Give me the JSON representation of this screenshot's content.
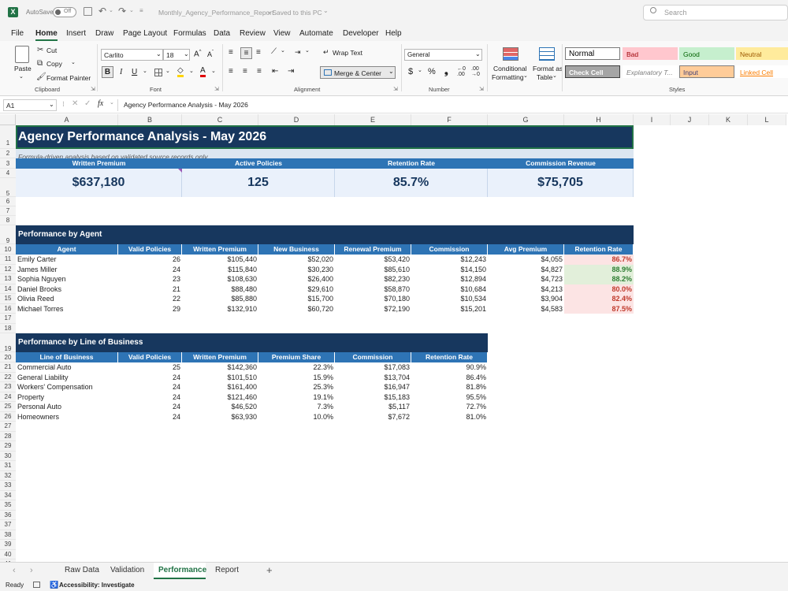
{
  "titlebar": {
    "autosave": "AutoSave",
    "autosave_state": "Off",
    "filename": "Monthly_Agency_Performance_Report",
    "saved": "• Saved to this PC",
    "search_placeholder": "Search"
  },
  "menu": [
    "File",
    "Home",
    "Insert",
    "Draw",
    "Page Layout",
    "Formulas",
    "Data",
    "Review",
    "View",
    "Automate",
    "Developer",
    "Help"
  ],
  "ribbon": {
    "paste": "Paste",
    "cut": "Cut",
    "copy": "Copy",
    "format_painter": "Format Painter",
    "clipboard": "Clipboard",
    "font_name": "Carlito",
    "font_size": "18",
    "font": "Font",
    "wrap_text": "Wrap Text",
    "merge_center": "Merge & Center",
    "alignment": "Alignment",
    "number_format": "General",
    "number": "Number",
    "conditional_formatting_1": "Conditional",
    "conditional_formatting_2": "Formatting",
    "format_as_table_1": "Format as",
    "format_as_table_2": "Table",
    "styles": "Styles",
    "style_cells": [
      {
        "label": "Normal",
        "bg": "#ffffff",
        "fg": "#000000",
        "border": "#7a7a7a"
      },
      {
        "label": "Bad",
        "bg": "#ffc7ce",
        "fg": "#9c0006",
        "border": "#ffc7ce"
      },
      {
        "label": "Good",
        "bg": "#c6efce",
        "fg": "#006100",
        "border": "#c6efce"
      },
      {
        "label": "Neutral",
        "bg": "#ffeb9c",
        "fg": "#9c5700",
        "border": "#ffeb9c"
      },
      {
        "label": "Check Cell",
        "bg": "#a5a5a5",
        "fg": "#ffffff",
        "border": "#3f3f3f"
      },
      {
        "label": "Explanatory T...",
        "bg": "#ffffff",
        "fg": "#7f7f7f",
        "border": "#ffffff"
      },
      {
        "label": "Input",
        "bg": "#ffcc99",
        "fg": "#3f3f76",
        "border": "#7f7f7f"
      },
      {
        "label": "Linked Cell",
        "bg": "#ffffff",
        "fg": "#fa7d00",
        "border": "#ffffff"
      }
    ]
  },
  "formula": {
    "cell_ref": "A1",
    "fx": "fx",
    "content": "Agency Performance Analysis - May 2026"
  },
  "columns": [
    "A",
    "B",
    "C",
    "D",
    "E",
    "F",
    "G",
    "H",
    "I",
    "J",
    "K",
    "L"
  ],
  "rows": [
    "1",
    "2",
    "3",
    "4",
    "5",
    "6",
    "7",
    "8",
    "9",
    "10",
    "11",
    "12",
    "13",
    "14",
    "15",
    "16",
    "17",
    "18",
    "19",
    "20",
    "21",
    "22",
    "23",
    "24",
    "25",
    "26",
    "27",
    "28",
    "29",
    "30",
    "31",
    "32",
    "33",
    "34",
    "35",
    "36",
    "37",
    "38",
    "39",
    "40",
    "41"
  ],
  "sheet": {
    "title": "Agency Performance Analysis - May 2026",
    "subtitle": "Formula-driven analysis based on validated source records only",
    "kpis": [
      {
        "label": "Written Premium",
        "value": "$637,180"
      },
      {
        "label": "Active Policies",
        "value": "125"
      },
      {
        "label": "Retention Rate",
        "value": "85.7%"
      },
      {
        "label": "Commission Revenue",
        "value": "$75,705"
      }
    ],
    "agent_section": "Performance by Agent",
    "agent_headers": [
      "Agent",
      "Valid Policies",
      "Written Premium",
      "New Business",
      "Renewal Premium",
      "Commission",
      "Avg Premium",
      "Retention Rate"
    ],
    "agents": [
      [
        "Emily Carter",
        "26",
        "$105,440",
        "$52,020",
        "$53,420",
        "$12,243",
        "$4,055",
        "86.7%"
      ],
      [
        "James Miller",
        "24",
        "$115,840",
        "$30,230",
        "$85,610",
        "$14,150",
        "$4,827",
        "88.9%"
      ],
      [
        "Sophia Nguyen",
        "23",
        "$108,630",
        "$26,400",
        "$82,230",
        "$12,894",
        "$4,723",
        "88.2%"
      ],
      [
        "Daniel Brooks",
        "21",
        "$88,480",
        "$29,610",
        "$58,870",
        "$10,684",
        "$4,213",
        "80.0%"
      ],
      [
        "Olivia Reed",
        "22",
        "$85,880",
        "$15,700",
        "$70,180",
        "$10,534",
        "$3,904",
        "82.4%"
      ],
      [
        "Michael Torres",
        "29",
        "$132,910",
        "$60,720",
        "$72,190",
        "$15,201",
        "$4,583",
        "87.5%"
      ]
    ],
    "agent_retention_status": [
      "bad",
      "good",
      "good",
      "bad",
      "bad",
      "bad"
    ],
    "lob_section": "Performance by Line of Business",
    "lob_headers": [
      "Line of Business",
      "Valid Policies",
      "Written Premium",
      "Premium Share",
      "Commission",
      "Retention Rate"
    ],
    "lobs": [
      [
        "Commercial Auto",
        "25",
        "$142,360",
        "22.3%",
        "$17,083",
        "90.9%"
      ],
      [
        "General Liability",
        "24",
        "$101,510",
        "15.9%",
        "$13,704",
        "86.4%"
      ],
      [
        "Workers' Compensation",
        "24",
        "$161,400",
        "25.3%",
        "$16,947",
        "81.8%"
      ],
      [
        "Property",
        "24",
        "$121,460",
        "19.1%",
        "$15,183",
        "95.5%"
      ],
      [
        "Personal Auto",
        "24",
        "$46,520",
        "7.3%",
        "$5,117",
        "72.7%"
      ],
      [
        "Homeowners",
        "24",
        "$63,930",
        "10.0%",
        "$7,672",
        "81.0%"
      ]
    ]
  },
  "tabs": [
    "Raw Data",
    "Validation",
    "Performance",
    "Report"
  ],
  "active_tab": "Performance",
  "status": {
    "ready": "Ready",
    "accessibility": "Accessibility: Investigate"
  },
  "colors": {
    "dark_blue": "#17375e",
    "mid_blue": "#2e74b5",
    "light_blue": "#dce6f1",
    "kpi_bg": "#eaf1fb",
    "excel_green": "#217346",
    "bad_fill": "#fce4e4",
    "bad_text": "#c0392b",
    "good_fill": "#e2efda",
    "good_text": "#2e7d32"
  }
}
